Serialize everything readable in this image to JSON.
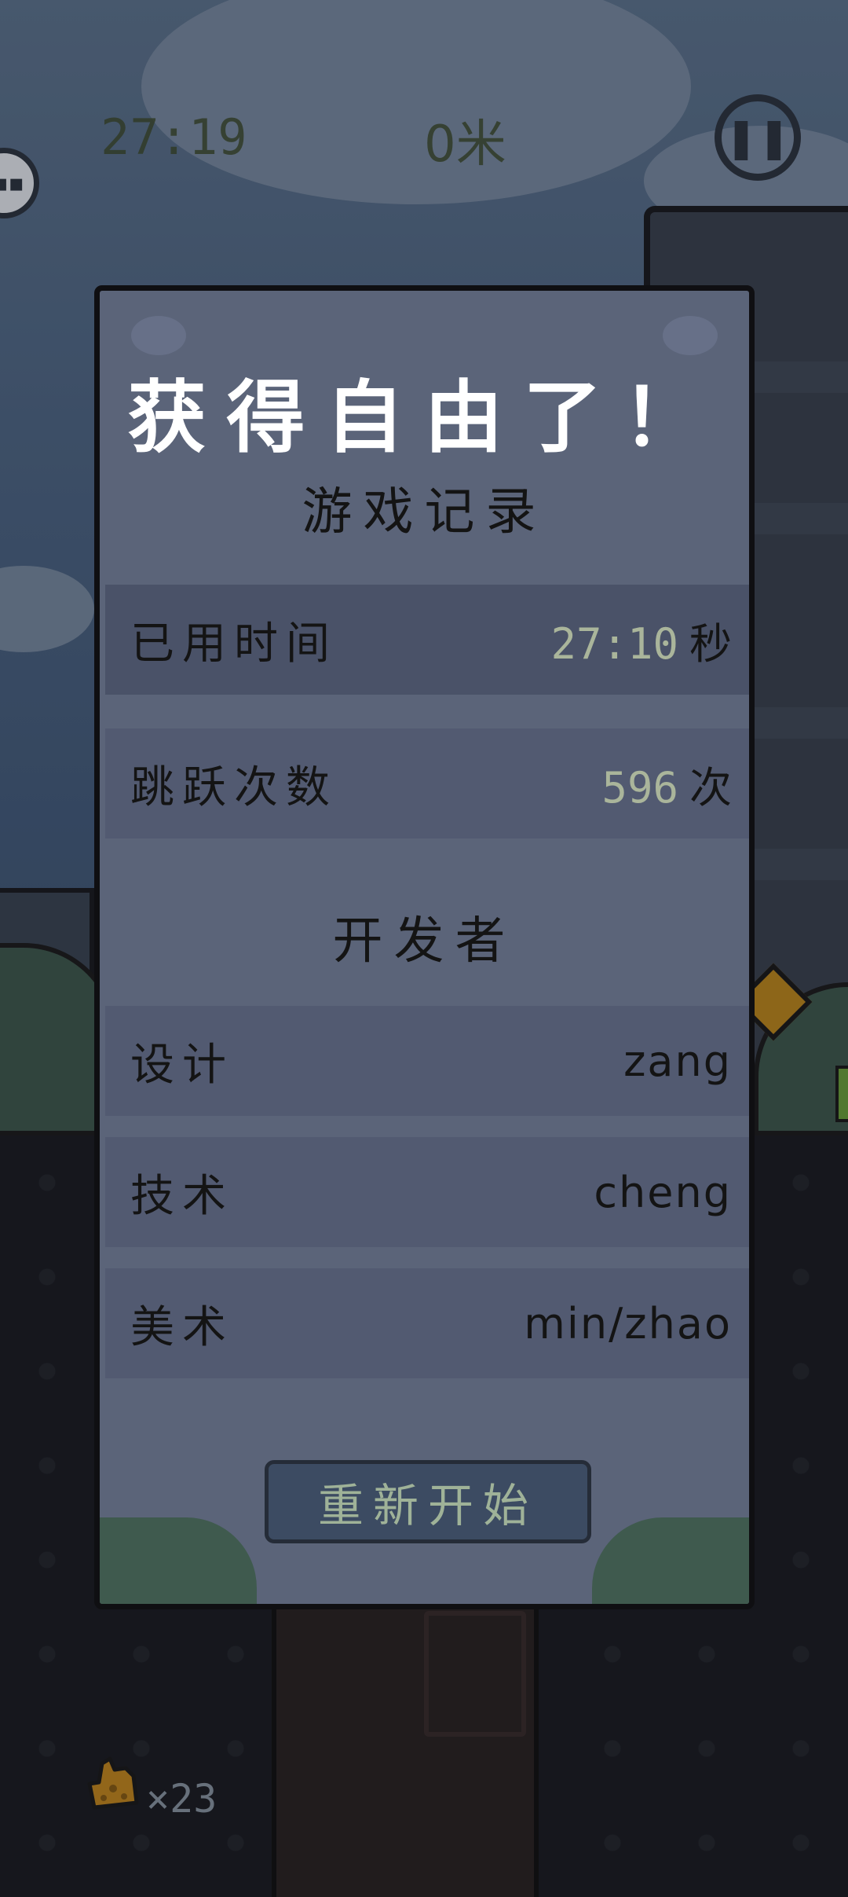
{
  "hud": {
    "time": "27:19",
    "distance": "0米",
    "pause_icon": "pause-icon",
    "sponge_count": "×23"
  },
  "dialog": {
    "title": "获得自由了！",
    "record_heading": "游戏记录",
    "records": [
      {
        "label": "已用时间",
        "value": "27:10",
        "unit": "秒"
      },
      {
        "label": "跳跃次数",
        "value": "596",
        "unit": "次"
      }
    ],
    "developers_heading": "开发者",
    "developers": [
      {
        "role": "设计",
        "name": "zang"
      },
      {
        "role": "技术",
        "name": "cheng"
      },
      {
        "role": "美术",
        "name": "min/zhao"
      }
    ],
    "restart_label": "重新开始"
  },
  "colors": {
    "dialog_bg": "#5b6479",
    "row_bg": "#525a71",
    "value_accent": "#aab59b",
    "button_bg": "#3c4b62",
    "button_text": "#9fb298"
  }
}
